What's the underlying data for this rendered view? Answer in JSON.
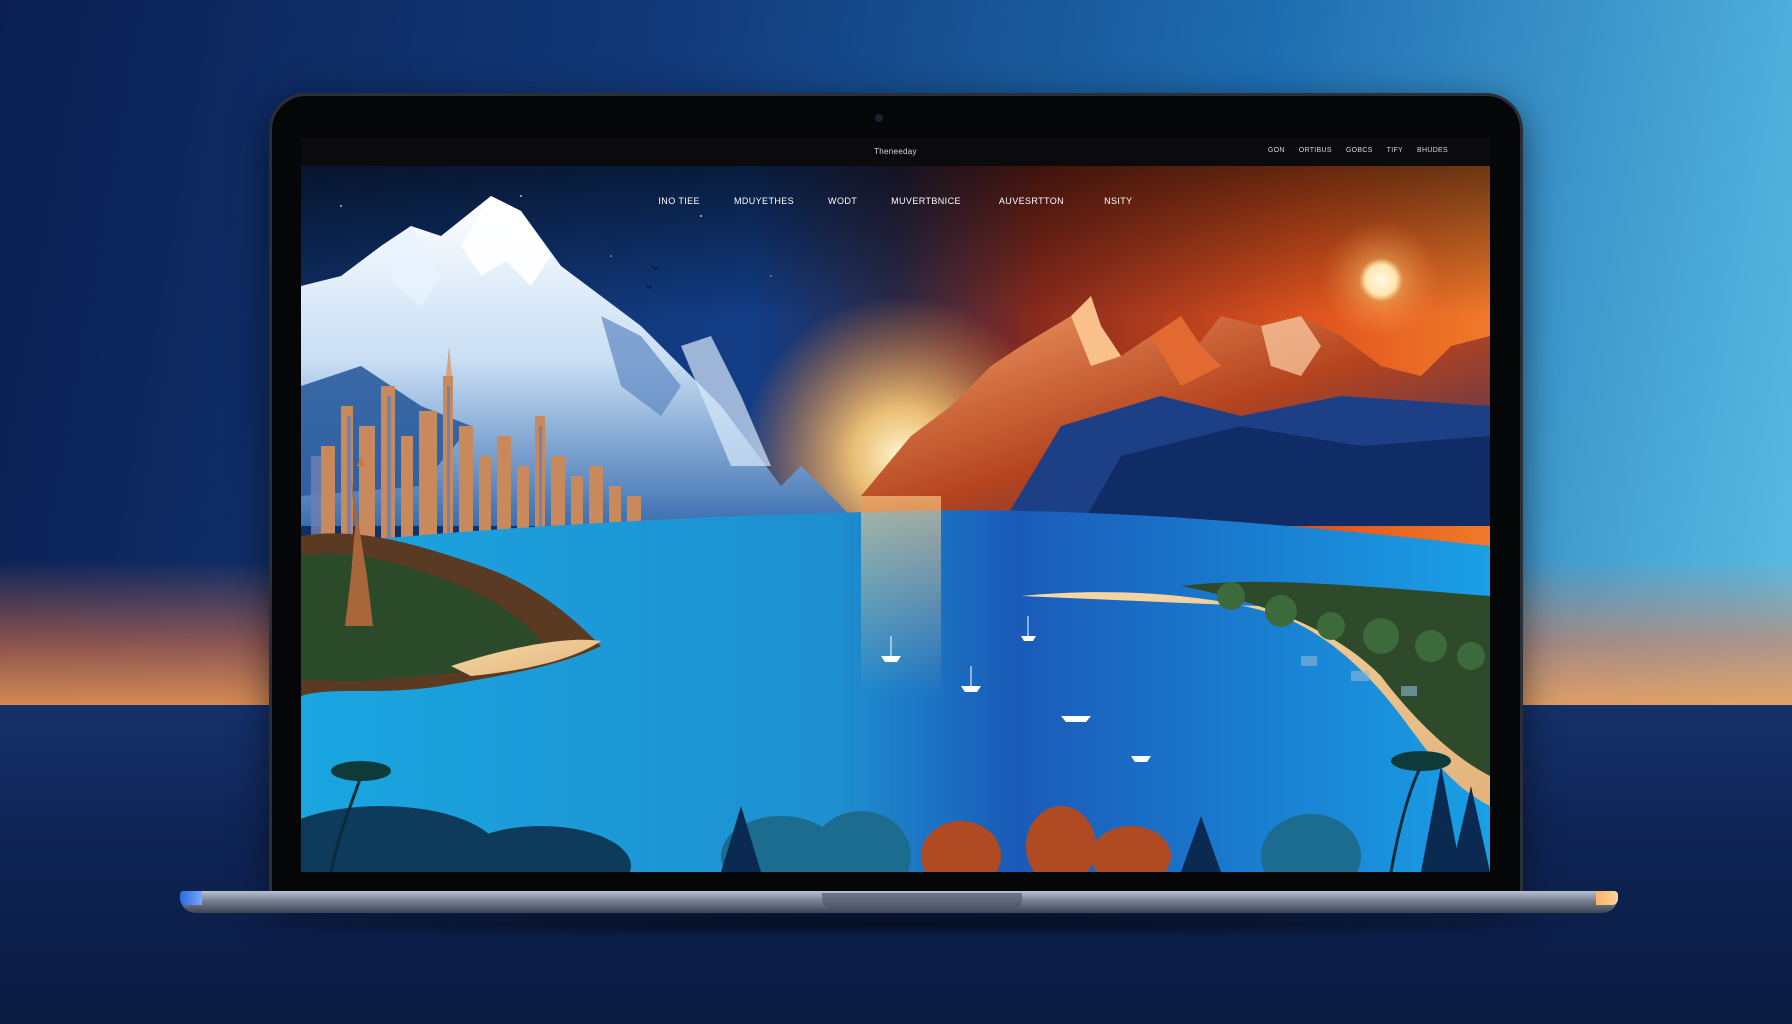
{
  "site": {
    "title": "Theneeday"
  },
  "utility_nav": [
    {
      "label": "GON"
    },
    {
      "label": "ORTIBUS"
    },
    {
      "label": "GOBCS"
    },
    {
      "label": "TIFY"
    },
    {
      "label": "BHUDES"
    }
  ],
  "main_nav": [
    {
      "label": "INO TIEE"
    },
    {
      "label": "MDUYETHES"
    },
    {
      "label": "WODT"
    },
    {
      "label": "MUVERTBNICE"
    },
    {
      "label": "AUVESRTTON"
    },
    {
      "label": "NSITY"
    }
  ],
  "colors": {
    "background_left": "#0b1f52",
    "background_right": "#5fc4e8",
    "sunset_orange": "#e8662a",
    "lake_cyan": "#1fb4e6"
  }
}
